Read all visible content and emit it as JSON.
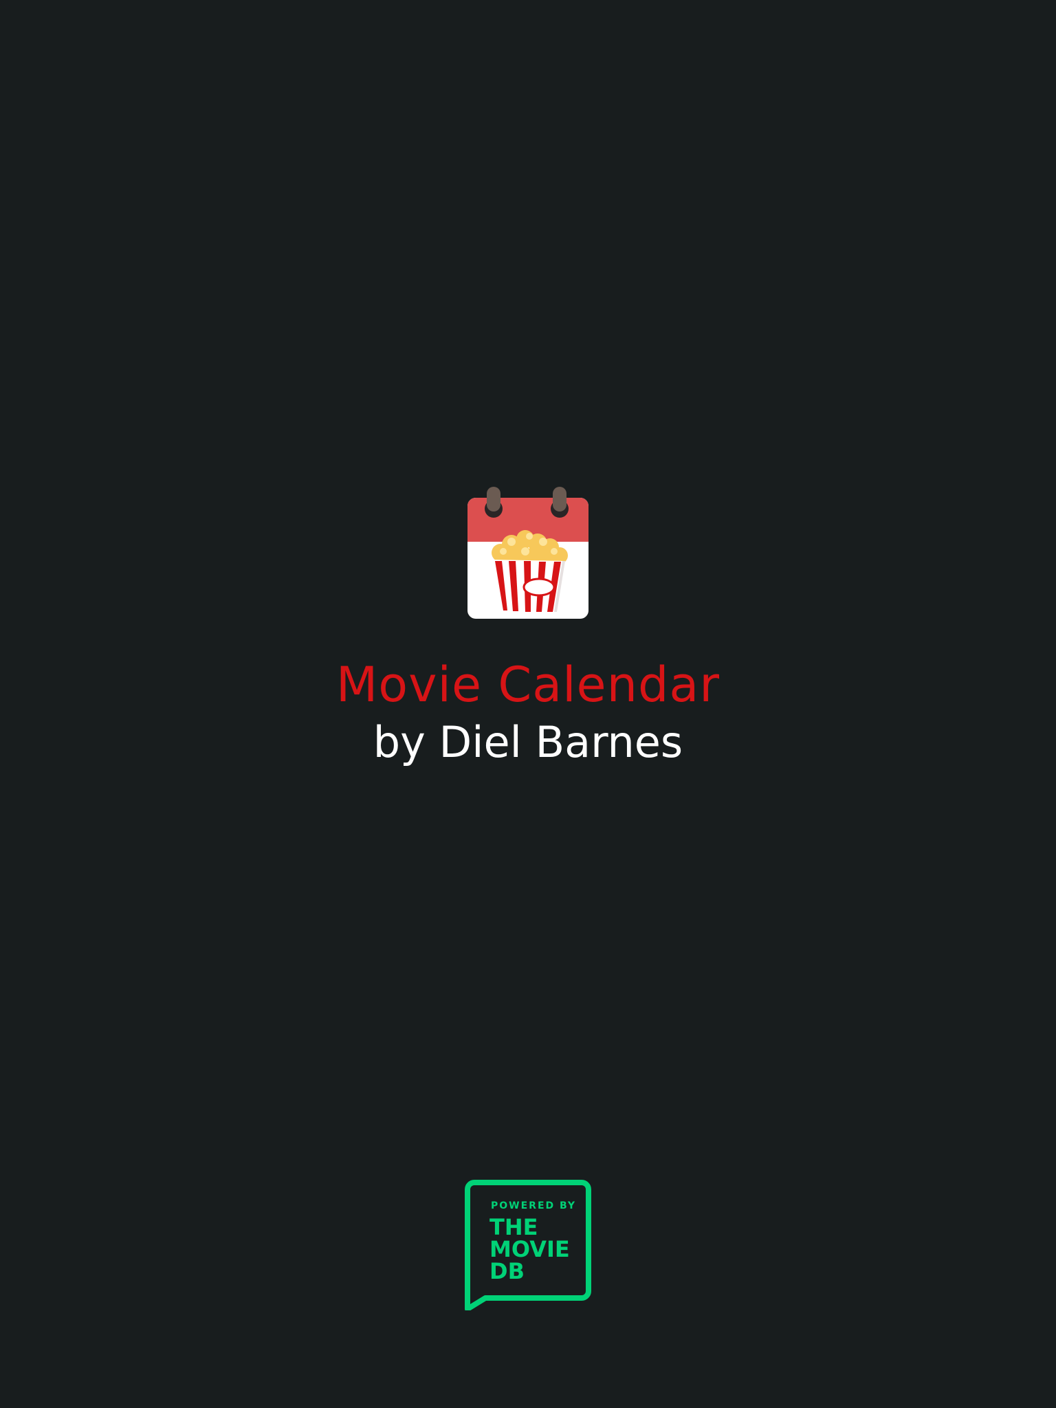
{
  "app": {
    "title": "Movie Calendar",
    "author": "by Diel Barnes",
    "title_color": "#d71416",
    "author_color": "#ffffff",
    "background_color": "#181d1e",
    "icon": "popcorn-calendar-icon"
  },
  "attribution": {
    "powered_by": "POWERED BY",
    "line1": "THE",
    "line2": "MOVIE",
    "line3": "DB",
    "brand_color": "#01d277",
    "icon": "tmdb-logo"
  }
}
